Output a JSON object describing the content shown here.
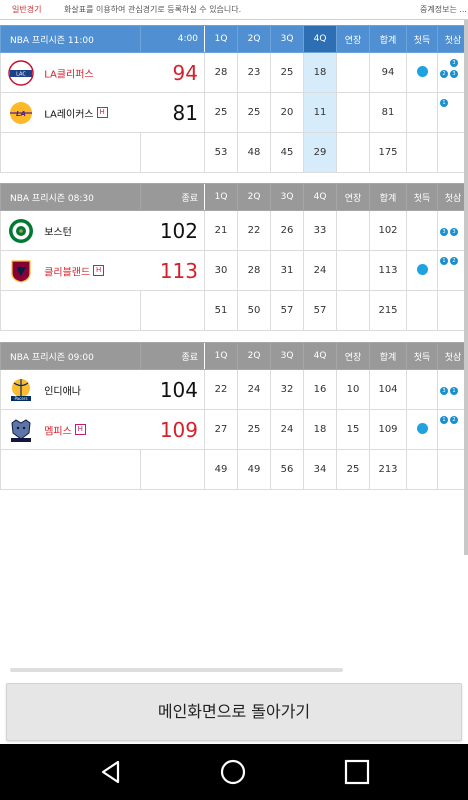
{
  "topbar": {
    "tab_label": "일반경기",
    "notice": "화살표를 이용하여 관심경기로 등록하실 수 있습니다.",
    "right_text": "중계정보는 ..."
  },
  "columns": {
    "q1": "1Q",
    "q2": "2Q",
    "q3": "3Q",
    "q4": "4Q",
    "ot": "연장",
    "total": "합계",
    "first": "첫득",
    "extra": "첫삼"
  },
  "games": [
    {
      "title": "NBA 프리시즌 11:00",
      "status": "4:00",
      "away": {
        "name": "LA클리퍼스",
        "logo": "clippers-logo",
        "score": "94",
        "q": [
          "28",
          "23",
          "25",
          "18"
        ],
        "ot": "",
        "total": "94"
      },
      "home": {
        "name": "LA레이커스",
        "logo": "lakers-logo",
        "score": "81",
        "q": [
          "25",
          "25",
          "20",
          "11"
        ],
        "ot": "",
        "total": "81"
      },
      "totals": {
        "q": [
          "53",
          "48",
          "45",
          "29"
        ],
        "ot": "",
        "total": "175"
      }
    },
    {
      "title": "NBA 프리시즌 08:30",
      "status": "종료",
      "away": {
        "name": "보스턴",
        "logo": "celtics-logo",
        "score": "102",
        "q": [
          "21",
          "22",
          "26",
          "33"
        ],
        "ot": "",
        "total": "102"
      },
      "home": {
        "name": "클리블랜드",
        "logo": "cavaliers-logo",
        "score": "113",
        "q": [
          "30",
          "28",
          "31",
          "24"
        ],
        "ot": "",
        "total": "113"
      },
      "totals": {
        "q": [
          "51",
          "50",
          "57",
          "57"
        ],
        "ot": "",
        "total": "215"
      }
    },
    {
      "title": "NBA 프리시즌 09:00",
      "status": "종료",
      "away": {
        "name": "인디애나",
        "logo": "pacers-logo",
        "score": "104",
        "q": [
          "22",
          "24",
          "32",
          "16"
        ],
        "ot": "10",
        "total": "104"
      },
      "home": {
        "name": "멤피스",
        "logo": "grizzlies-logo",
        "score": "109",
        "q": [
          "27",
          "25",
          "24",
          "18"
        ],
        "ot": "15",
        "total": "109"
      },
      "totals": {
        "q": [
          "49",
          "49",
          "56",
          "34"
        ],
        "ot": "25",
        "total": "213"
      }
    }
  ],
  "home_badge": "H",
  "mini_badges": {
    "a": "3",
    "b": "2",
    "c": "3",
    "d": "1",
    "e": "2"
  },
  "main_button": "메인화면으로 돌아가기",
  "colors": {
    "accent": "#4f8fd2",
    "finished_header": "#999999",
    "highlight": "#d6ecfb",
    "winner_red": "#d6202a",
    "indicator": "#1fa2e0"
  }
}
